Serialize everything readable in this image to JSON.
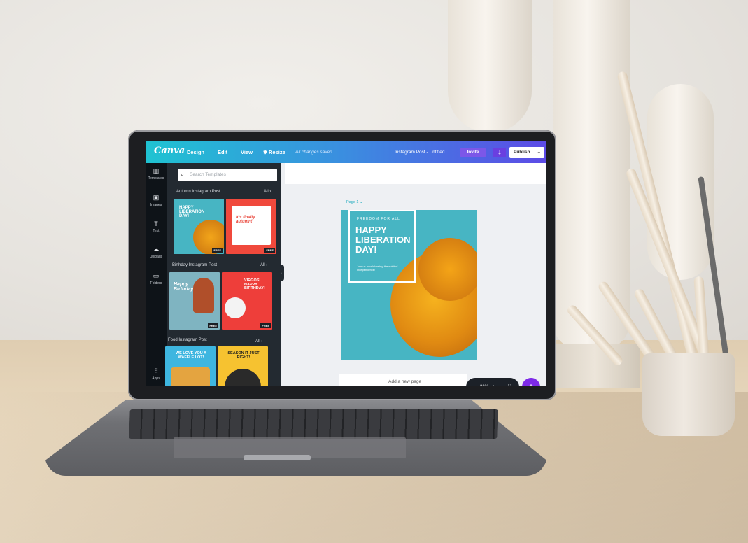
{
  "app": {
    "logo": "Canva"
  },
  "topbar": {
    "menu": [
      "Design",
      "Edit",
      "View",
      "Resize"
    ],
    "saved_status": "All changes saved",
    "doc_title": "Instagram Post - Untitled",
    "invite_label": "Invite",
    "publish_label": "Publish",
    "accent": "#7d2ae8"
  },
  "rail": {
    "items": [
      {
        "label": "Templates",
        "icon": "templates-icon"
      },
      {
        "label": "Images",
        "icon": "images-icon"
      },
      {
        "label": "Text",
        "icon": "text-icon"
      },
      {
        "label": "Uploads",
        "icon": "uploads-icon"
      },
      {
        "label": "Folders",
        "icon": "folder-icon"
      }
    ],
    "apps_label": "Apps"
  },
  "panel": {
    "search_placeholder": "Search Templates",
    "sections": [
      {
        "title": "Autumn Instagram Post",
        "all": "All"
      },
      {
        "title": "Birthday Instagram Post",
        "all": "All"
      },
      {
        "title": "Food Instagram Post",
        "all": "All"
      }
    ],
    "tiles": {
      "autumn1": "HAPPY LIBERATION DAY!",
      "autumn2": "It's finally autumn!",
      "birthday1": "Happy Birthday!",
      "birthday2": "VIRGOS! HAPPY BIRTHDAY!",
      "food1": "WE LOVE YOU A WAFFLE LOT!",
      "food2": "SEASON IT JUST RIGHT!",
      "free_badge": "FREE"
    }
  },
  "canvas": {
    "page_label": "Page 1",
    "design": {
      "kicker": "FREEDOM FOR ALL",
      "headline_lines": [
        "HAPPY",
        "LIBERATION",
        "DAY!"
      ],
      "subtext": "Join us in celebrating the spirit of independence!"
    },
    "add_page_label": "+ Add a new page",
    "zoom_label": "36%"
  }
}
